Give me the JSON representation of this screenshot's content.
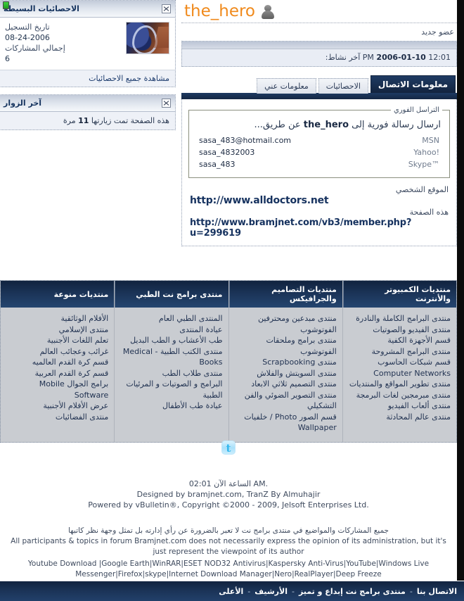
{
  "user": {
    "name": "the_hero",
    "title": "عضو جديد",
    "online_status": "online",
    "last_activity_label": "آخر نشاط:",
    "last_activity_value": "2006-01-10",
    "last_activity_time": "12:01 PM"
  },
  "sidebar": {
    "stats_panel": {
      "title": "الاحصائيات البسيطة",
      "join_label": "تاريخ التسجيل",
      "join_value": "08-24-2006",
      "posts_label": "إجمالي المشاركات",
      "posts_value": "6",
      "view_all": "مشاهدة جميع الاحصائيات"
    },
    "visitors_panel": {
      "title": "آخر الزوار",
      "visits_prefix": "هذه الصفحة تمت زيارتها",
      "visits_count": "11",
      "visits_suffix": "مرة"
    }
  },
  "tabs": [
    {
      "label": "معلومات الاتصال",
      "active": true
    },
    {
      "label": "الاحصائيات",
      "active": false
    },
    {
      "label": "معلومات عني",
      "active": false
    }
  ],
  "contact": {
    "im_legend": "التراسل الفوري",
    "im_lead_prefix": "ارسال رسالة فورية إلى",
    "im_lead_user": "the_hero",
    "im_lead_suffix": "عن طريق...",
    "im_rows": [
      {
        "service": "MSN",
        "handle": "sasa_483@hotmail.com"
      },
      {
        "service": "Yahoo!",
        "handle": "sasa_4832003"
      },
      {
        "service": "Skype™",
        "handle": "sasa_483"
      }
    ],
    "homepage_label": "الموقع الشخصي",
    "homepage_value": "http://www.alldoctors.net",
    "thispage_label": "هذه الصفحة",
    "thispage_value": "http://www.bramjnet.com/vb3/member.php?u=299619"
  },
  "forum_columns": [
    {
      "title": "منتديات الكمبيوتر والأنترنت",
      "links": [
        "منتدى البرامج الكاملة والنادرة",
        "منتدى الفيديو والصوتيات",
        "قسم الأجهزة الكفية",
        "منتدى البرامج المشروحة",
        "قسم شبكات الحاسوب Computer Networks",
        "منتدى تطوير المواقع والمنتديات",
        "منتدى مبرمجين لغات البرمجة",
        "منتدى ألعاب الفيديو",
        "منتدى عالم المحادثة"
      ]
    },
    {
      "title": "منتديات التصاميم والجرافيكس",
      "links": [
        "منتدى مبدعين ومحترفين الفوتوشوب",
        "منتدى برامج وملحقات الفوتوشوب",
        "منتدى Scrapbooking",
        "منتدى السويتش والفلاش",
        "منتدى التصميم ثلاثي الابعاد",
        "منتدى التصوير الضوئي والفن التشكيلي",
        "قسم الصور Photo / خلفيات Wallpaper"
      ]
    },
    {
      "title": "منتدى برامج نت الطبي",
      "links": [
        "المنتدى الطبي العام",
        "عيادة المنتدى",
        "طب الأعشاب و الطب البديل",
        "منتدى الكتب الطبية - Medical Books",
        "منتدى طلاب الطب",
        "البرامج و الصوتيات و المرئيات الطبية",
        "عيادة طب الأطفال"
      ]
    },
    {
      "title": "منتديات منوعة",
      "links": [
        "الأفلام الوثائقية",
        "منتدى الإسلامي",
        "تعلم اللغات الأجنبية",
        "غرائب وعجائب العالم",
        "قسم كرة القدم العالميه",
        "قسم كرة القدم العربية",
        "برامج الجوال Mobile Software",
        "عرض الأفلام الأجنبية",
        "منتدى الفضائيات"
      ]
    }
  ],
  "footer": {
    "twitter_icon": "twitter-icon",
    "time_line": "الساعة الآن 02:01 AM.",
    "designed_line": "Designed by bramjnet.com, TranZ By Almuhajir",
    "powered_line": "Powered by vBulletin®, Copyright ©2000 - 2009, Jelsoft Enterprises Ltd.",
    "disclaimer_ar": "جميع المشاركات والمواضيع في منتدى برامج نت لا تعبر بالضرورة عن رأي إدارته بل تمثل وجهة نظر كاتبها",
    "disclaimer_en": "All participants & topics in forum Bramjnet.com does not necessarily express the opinion of its administration, but it's just represent the viewpoint of its author",
    "keyword_links": "Youtube Download |Google Earth|WinRAR|ESET NOD32 Antivirus|Kaspersky Anti-Virus|YouTube|Windows Live Messenger|Firefox|skype|Internet Download Manager|Nero|RealPlayer|Deep Freeze"
  },
  "bottombar": {
    "items": [
      "الاتصال بنا",
      "منتدى برامج نت إبداع و تميز",
      "الأرشيف",
      "الأعلى"
    ],
    "separator": "-"
  },
  "colors": {
    "username": "#f08a1c",
    "header_dark": "#14263f",
    "online_green": "#2fb72f"
  }
}
